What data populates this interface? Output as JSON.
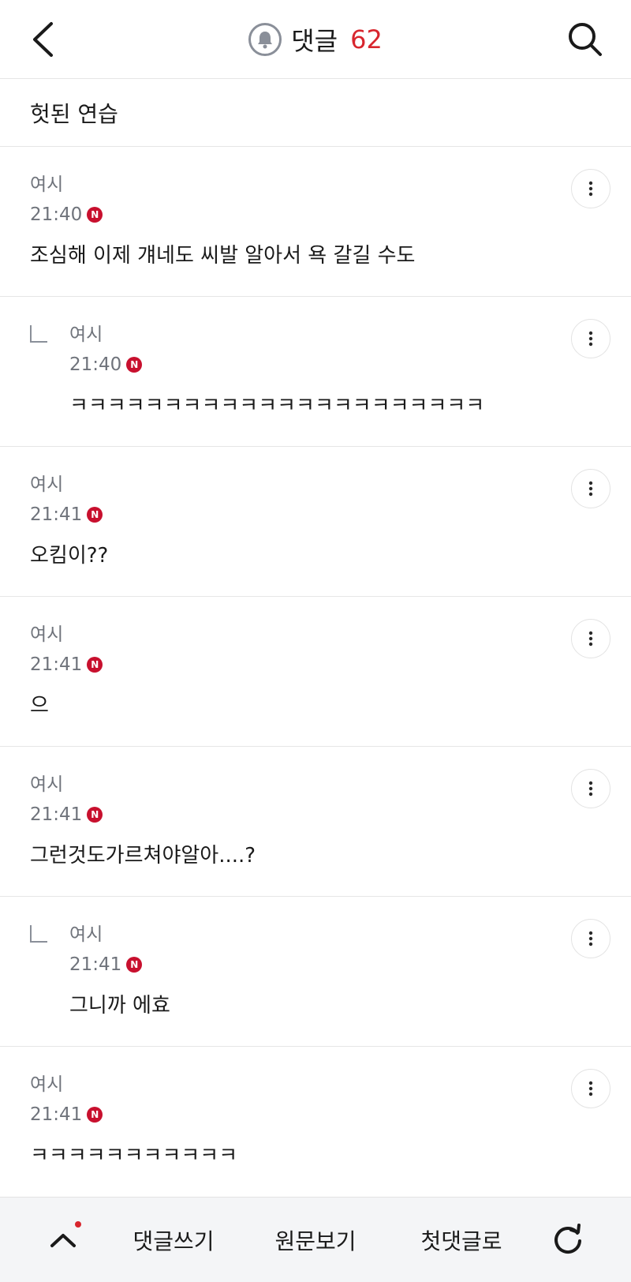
{
  "header": {
    "title": "댓글",
    "count": "62",
    "back_icon": "chevron-left-icon",
    "search_icon": "search-icon",
    "bell_icon": "bell-icon"
  },
  "post": {
    "title": "헛된 연습"
  },
  "comments": [
    {
      "author": "여시",
      "time": "21:40",
      "text": "조심해 이제 걔네도 씨발 알아서 욕 갈길 수도",
      "reply": false
    },
    {
      "author": "여시",
      "time": "21:40",
      "text": "ㅋㅋㅋㅋㅋㅋㅋㅋㅋㅋㅋㅋㅋㅋㅋㅋㅋㅋㅋㅋㅋㅋ",
      "reply": true
    },
    {
      "author": "여시",
      "time": "21:41",
      "text": "오킴이??",
      "reply": false
    },
    {
      "author": "여시",
      "time": "21:41",
      "text": "으",
      "reply": false
    },
    {
      "author": "여시",
      "time": "21:41",
      "text": "그런것도가르쳐야알아....?",
      "reply": false
    },
    {
      "author": "여시",
      "time": "21:41",
      "text": "그니까 에효",
      "reply": true
    },
    {
      "author": "여시",
      "time": "21:41",
      "text": "ㅋㅋㅋㅋㅋㅋㅋㅋㅋㅋㅋ",
      "reply": false
    }
  ],
  "badge": {
    "label": "N",
    "color": "#c8102e"
  },
  "bottom_bar": {
    "write": "댓글쓰기",
    "original": "원문보기",
    "first": "첫댓글로",
    "up_icon": "chevron-up-icon",
    "refresh_icon": "refresh-icon"
  },
  "colors": {
    "accent": "#d8262e",
    "muted": "#6f737b"
  }
}
